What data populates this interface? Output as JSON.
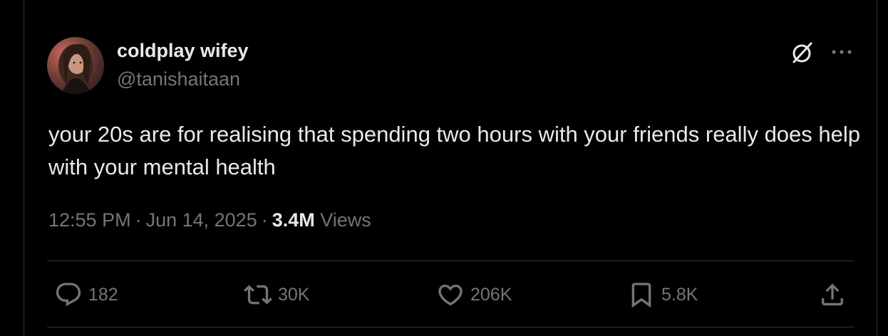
{
  "author": {
    "display_name": "coldplay wifey",
    "handle": "@tanishaitaan",
    "avatar_alt": "profile photo"
  },
  "tweet": {
    "text": "your 20s are for realising that spending two hours with your friends really does help with your mental health",
    "time": "12:55 PM",
    "date": "Jun 14, 2025",
    "separator": "·",
    "views_count": "3.4M",
    "views_label": "Views"
  },
  "actions": {
    "replies": "182",
    "reposts": "30K",
    "likes": "206K",
    "bookmarks": "5.8K"
  },
  "icons": {
    "grok": "grok-icon",
    "more": "more-horizontal-icon",
    "reply": "reply-icon",
    "repost": "repost-icon",
    "like": "heart-icon",
    "bookmark": "bookmark-icon",
    "share": "share-icon"
  },
  "colors": {
    "background": "#000000",
    "text_primary": "#e7e9ea",
    "text_secondary": "#71767b",
    "border": "#2f3336"
  }
}
